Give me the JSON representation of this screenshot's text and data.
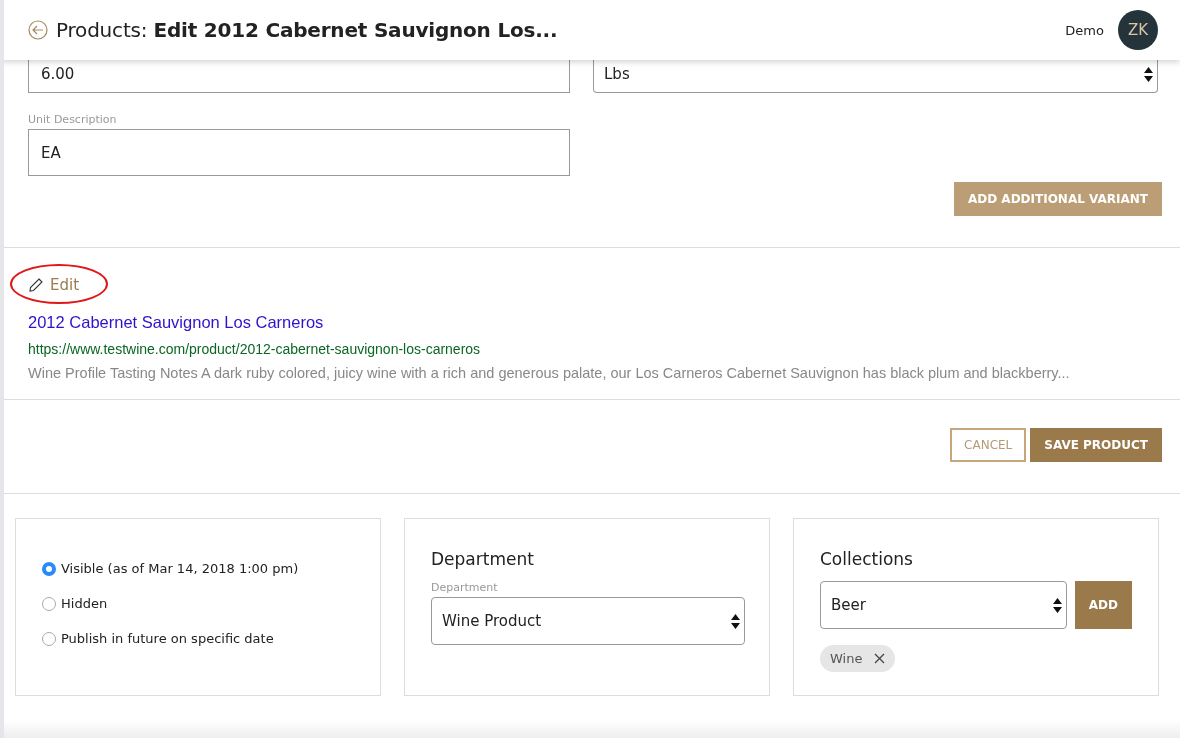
{
  "header": {
    "title_prefix": "Products:",
    "title": "Edit 2012 Cabernet Sauvignon Los...",
    "user_name": "Demo",
    "avatar_initials": "ZK"
  },
  "variant": {
    "weight_value": "6.00",
    "unit_select": "Lbs",
    "unit_description_label": "Unit Description",
    "unit_description_value": "EA",
    "add_button": "ADD ADDITIONAL VARIANT"
  },
  "seo_preview": {
    "edit_label": "Edit",
    "circled": true,
    "title": "2012 Cabernet Sauvignon Los Carneros",
    "url": "https://www.testwine.com/product/2012-cabernet-sauvignon-los-carneros",
    "description": "Wine Profile Tasting Notes A dark ruby colored, juicy wine with a rich and generous palate, our Los Carneros Cabernet Sauvignon has black plum and blackberry..."
  },
  "actions": {
    "cancel": "CANCEL",
    "save": "SAVE PRODUCT"
  },
  "visibility": [
    {
      "label": "Visible (as of Mar 14, 2018 1:00 pm)",
      "selected": true
    },
    {
      "label": "Hidden",
      "selected": false
    },
    {
      "label": "Publish in future on specific date",
      "selected": false
    }
  ],
  "department": {
    "heading": "Department",
    "label": "Department",
    "value": "Wine Product"
  },
  "collections": {
    "heading": "Collections",
    "value": "Beer",
    "add_button": "ADD",
    "tags": [
      "Wine"
    ]
  }
}
